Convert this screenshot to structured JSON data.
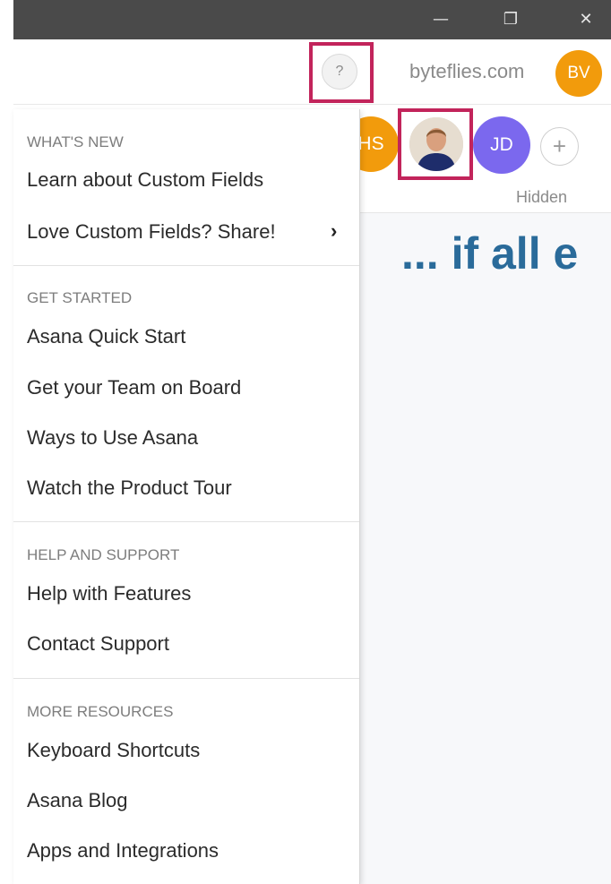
{
  "titlebar": {
    "minimize_icon": "minimize-icon",
    "maximize_icon": "restore-icon",
    "close_icon": "close-icon",
    "minimize_glyph": "—",
    "maximize_glyph": "❐",
    "close_glyph": "✕"
  },
  "topbar": {
    "help_label": "?",
    "domain": "byteflies.com",
    "user_initials": "BV"
  },
  "members": {
    "avatars": [
      "HS",
      "JD"
    ],
    "add_label": "+",
    "hidden_label": "Hidden"
  },
  "main": {
    "headline": "... if all e"
  },
  "menu": {
    "sections": [
      {
        "heading": "WHAT'S NEW",
        "items": [
          "Learn about Custom Fields",
          "Love Custom Fields? Share!"
        ]
      },
      {
        "heading": "GET STARTED",
        "items": [
          "Asana Quick Start",
          "Get your Team on Board",
          "Ways to Use Asana",
          "Watch the Product Tour"
        ]
      },
      {
        "heading": "HELP AND SUPPORT",
        "items": [
          "Help with Features",
          "Contact Support"
        ]
      },
      {
        "heading": "MORE RESOURCES",
        "items": [
          "Keyboard Shortcuts",
          "Asana Blog",
          "Apps and Integrations"
        ]
      }
    ],
    "chevron": "›"
  },
  "colors": {
    "highlight": "#c2245b",
    "avatar_orange": "#f29b0c",
    "avatar_purple": "#7b68ee",
    "headline_blue": "#2a6b9a"
  }
}
